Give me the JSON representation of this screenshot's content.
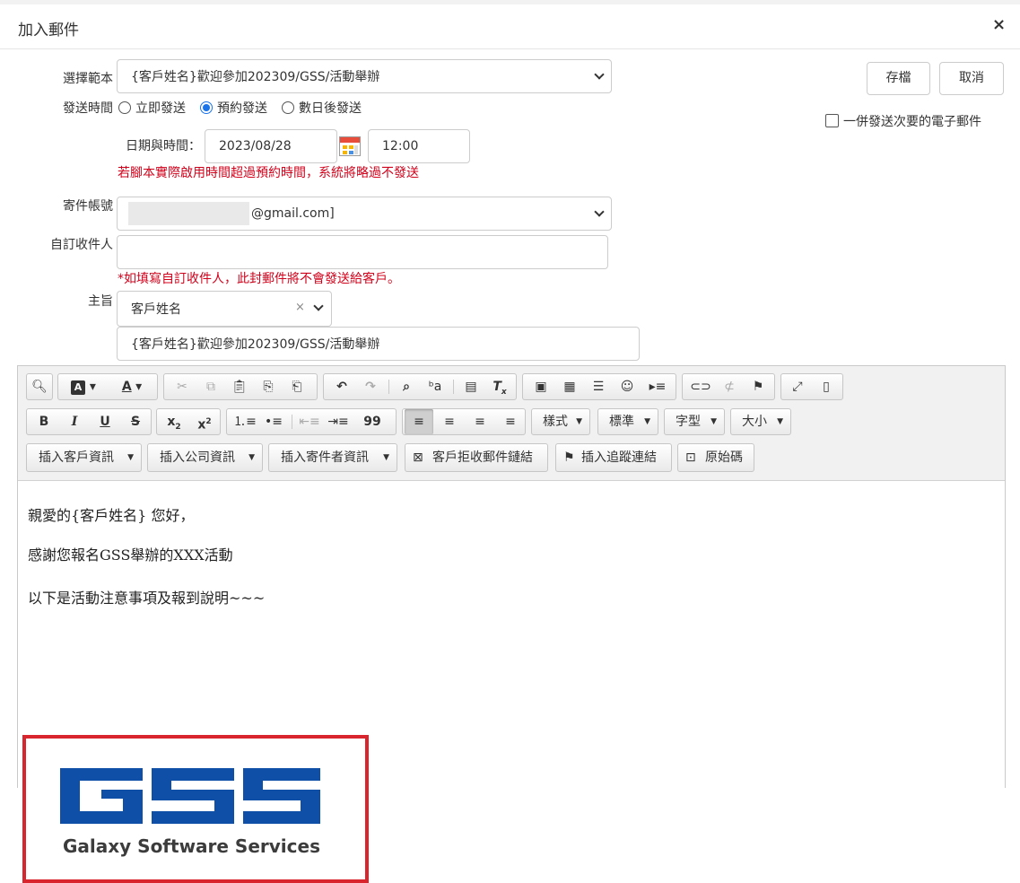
{
  "header": {
    "title": "加入郵件",
    "close": "×"
  },
  "actions": {
    "save": "存檔",
    "cancel": "取消"
  },
  "form": {
    "template": {
      "label": "選擇範本",
      "value": "{客戶姓名}歡迎參加202309/GSS/活動舉辦"
    },
    "send_time": {
      "label": "發送時間",
      "options": [
        "立即發送",
        "預約發送",
        "數日後發送"
      ],
      "selected": "預約發送"
    },
    "combine": {
      "label": "一併發送次要的電子郵件",
      "checked": false
    },
    "datetime": {
      "label": "日期與時間：",
      "date": "2023/08/28",
      "time": "12:00"
    },
    "datetime_warning": "若腳本實際啟用時間超過預約時間，系統將略過不發送",
    "account": {
      "label": "寄件帳號",
      "value": "@gmail.com]"
    },
    "custom_recipient": {
      "label": "自訂收件人",
      "value": "",
      "note": "*如填寫自訂收件人，此封郵件將不會發送給客戶。"
    },
    "subject": {
      "label": "主旨",
      "tag_value": "客戶姓名",
      "value": "{客戶姓名}歡迎參加202309/GSS/活動舉辦"
    }
  },
  "toolbar": {
    "row1": [
      "preview-icon",
      "text-color-icon",
      "bg-color-icon",
      "cut-icon",
      "copy-icon",
      "paste-icon",
      "paste-text-icon",
      "paste-word-icon",
      "undo-icon",
      "redo-icon",
      "find-icon",
      "replace-icon",
      "select-all-icon",
      "remove-format-icon",
      "image-icon",
      "table-icon",
      "horizontal-rule-icon",
      "smiley-icon",
      "page-break-icon",
      "link-icon",
      "unlink-icon",
      "anchor-icon",
      "maximize-icon",
      "show-blocks-icon"
    ],
    "styles": {
      "format": "樣式",
      "paragraph": "標準",
      "font": "字型",
      "size": "大小"
    },
    "insert_customer": "插入客戶資訊",
    "insert_company": "插入公司資訊",
    "insert_sender": "插入寄件者資訊",
    "unsubscribe_link": "客戶拒收郵件鏈結",
    "tracking_link": "插入追蹤連結",
    "source": "原始碼"
  },
  "body": {
    "line1": "親愛的{客戶姓名} 您好，",
    "line2": "感謝您報名GSS舉辦的XXX活動",
    "line3": "以下是活動注意事項及報到說明~~~",
    "image": {
      "logo_text": "Galaxy Software Services",
      "brand_color": "#0f4fa8",
      "border_color": "#d9262e"
    }
  },
  "colors": {
    "accent": "#1a73e8",
    "warning": "#d0021b"
  }
}
